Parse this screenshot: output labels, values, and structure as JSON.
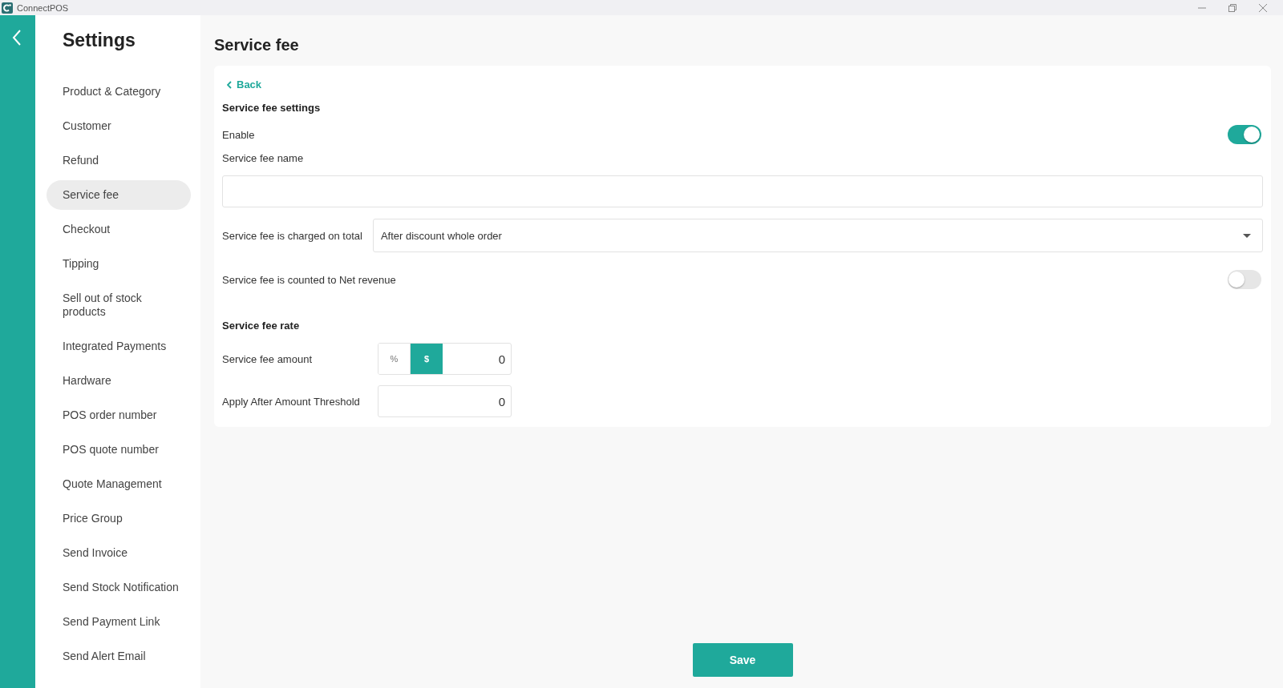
{
  "window": {
    "title": "ConnectPOS"
  },
  "sidebar": {
    "title": "Settings",
    "items": [
      {
        "label": "Product & Category",
        "selected": false
      },
      {
        "label": "Customer",
        "selected": false
      },
      {
        "label": "Refund",
        "selected": false
      },
      {
        "label": "Service fee",
        "selected": true
      },
      {
        "label": "Checkout",
        "selected": false
      },
      {
        "label": "Tipping",
        "selected": false
      },
      {
        "label": "Sell out of stock products",
        "selected": false
      },
      {
        "label": "Integrated Payments",
        "selected": false
      },
      {
        "label": "Hardware",
        "selected": false
      },
      {
        "label": "POS order number",
        "selected": false
      },
      {
        "label": "POS quote number",
        "selected": false
      },
      {
        "label": "Quote Management",
        "selected": false
      },
      {
        "label": "Price Group",
        "selected": false
      },
      {
        "label": "Send Invoice",
        "selected": false
      },
      {
        "label": "Send Stock Notification",
        "selected": false
      },
      {
        "label": "Send Payment Link",
        "selected": false
      },
      {
        "label": "Send Alert Email",
        "selected": false
      }
    ]
  },
  "page": {
    "title": "Service fee",
    "back": "Back",
    "rows": [
      {
        "kind": "heading",
        "label": "Service fee settings"
      },
      {
        "kind": "toggle",
        "label": "Enable",
        "on": true
      },
      {
        "kind": "text",
        "label": "Service fee name"
      },
      {
        "kind": "select",
        "label": "Service fee is charged on total",
        "value": "After discount whole order"
      },
      {
        "kind": "toggle",
        "label": "Service fee is counted to Net revenue",
        "on": false
      },
      {
        "kind": "heading",
        "label": "Service fee rate"
      },
      {
        "kind": "segmented",
        "label": "Service fee amount",
        "options": [
          {
            "label": "%",
            "selected": false
          },
          {
            "label": "$",
            "selected": true
          }
        ],
        "value": "0"
      },
      {
        "kind": "number",
        "label": "Apply After Amount Threshold",
        "value": "0"
      }
    ],
    "save": "Save"
  }
}
